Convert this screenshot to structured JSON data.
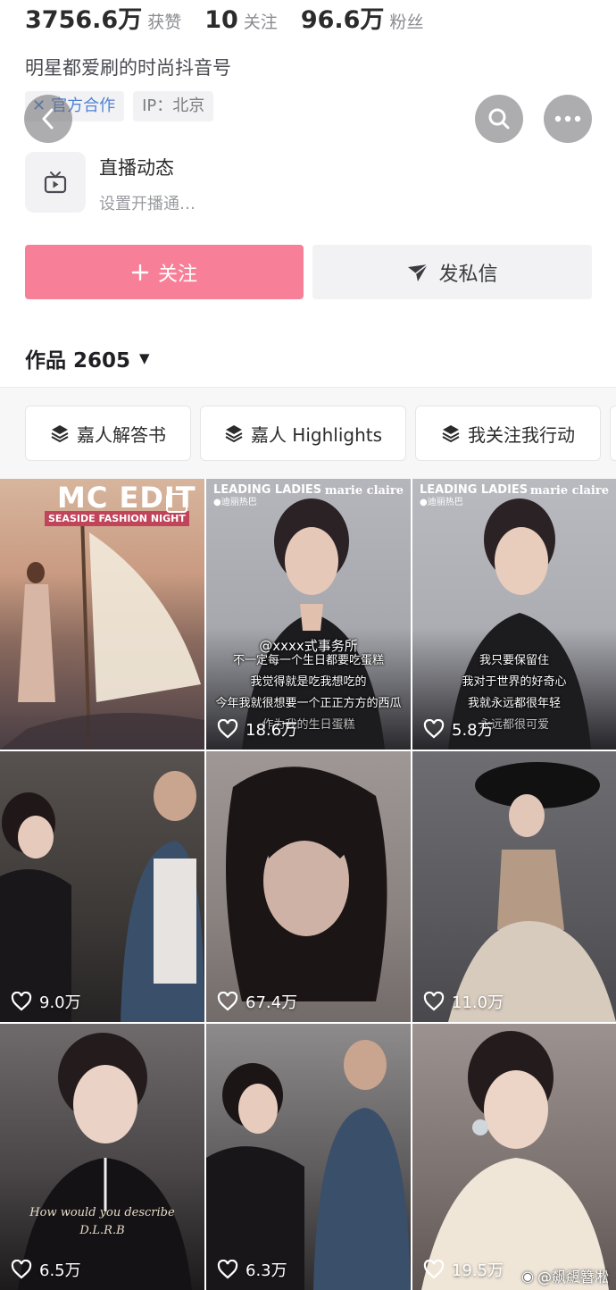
{
  "profile": {
    "stats": [
      {
        "value": "3756.6万",
        "label": "获赞"
      },
      {
        "value": "10",
        "label": "关注"
      },
      {
        "value": "96.6万",
        "label": "粉丝"
      }
    ],
    "bio": "明星都爱刷的时尚抖音号",
    "tags": {
      "official": "官方合作",
      "ip": "IP：北京"
    }
  },
  "live": {
    "title": "直播动态",
    "subtitle": "设置开播通…"
  },
  "actions": {
    "follow": "关注",
    "message": "发私信"
  },
  "works": {
    "label": "作品 2605"
  },
  "collections": [
    "嘉人解答书",
    "嘉人 Highlights",
    "我关注我行动"
  ],
  "videos": [
    {
      "likes": "",
      "title": "MC EDIT",
      "subtitle": "SEASIDE FASHION NIGHT"
    },
    {
      "likes": "18.6万",
      "brand_left": "LEADING LADIES",
      "brand_left_sub": "●迪丽热巴",
      "brand_right": "marie claire",
      "lines": [
        "不一定每一个生日都要吃蛋糕",
        "我觉得就是吃我想吃的",
        "今年我就很想要一个正正方方的西瓜",
        "作为我的生日蛋糕"
      ],
      "overlay": "@xxxx式事务所"
    },
    {
      "likes": "5.8万",
      "brand_left": "LEADING LADIES",
      "brand_left_sub": "●迪丽热巴",
      "brand_right": "marie claire",
      "lines": [
        "我只要保留住",
        "我对于世界的好奇心",
        "我就永远都很年轻",
        "永远都很可爱"
      ]
    },
    {
      "likes": "9.0万"
    },
    {
      "likes": "67.4万"
    },
    {
      "likes": "11.0万"
    },
    {
      "likes": "6.5万",
      "quote": "How would you describe",
      "quote2": "D.L.R.B"
    },
    {
      "likes": "6.3万"
    },
    {
      "likes": "19.5万"
    }
  ],
  "watermark": "@飙飊簪凇",
  "colors": {
    "follow": "#f77f98",
    "official": "#4f83d6"
  }
}
